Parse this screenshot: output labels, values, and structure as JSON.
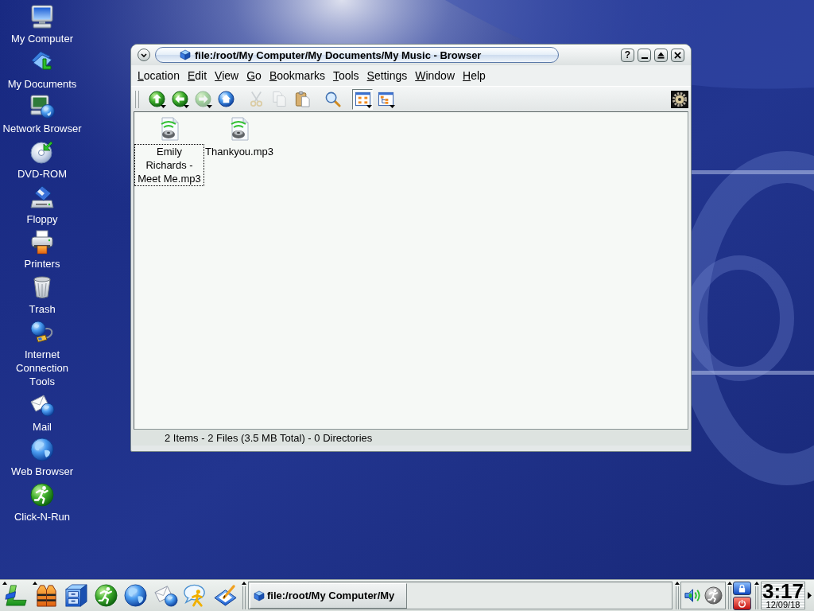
{
  "desktop_icons": [
    {
      "kind": "computer",
      "label": "My Computer"
    },
    {
      "kind": "documents",
      "label": "My Documents"
    },
    {
      "kind": "network",
      "label": "Network Browser"
    },
    {
      "kind": "dvd",
      "label": "DVD-ROM"
    },
    {
      "kind": "floppy",
      "label": "Floppy"
    },
    {
      "kind": "printer",
      "label": "Printers"
    },
    {
      "kind": "trash",
      "label": "Trash"
    },
    {
      "kind": "internet-tools",
      "label": "Internet Connection Tools"
    },
    {
      "kind": "mail",
      "label": "Mail"
    },
    {
      "kind": "web",
      "label": "Web Browser"
    },
    {
      "kind": "run",
      "label": "Click-N-Run"
    }
  ],
  "window": {
    "title": "file:/root/My Computer/My Documents/My Music - Browser",
    "help_button": "?",
    "menu": [
      "Location",
      "Edit",
      "View",
      "Go",
      "Bookmarks",
      "Tools",
      "Settings",
      "Window",
      "Help"
    ],
    "toolbar": [
      {
        "kind": "up",
        "disabled": false,
        "pressed": false,
        "dropdown": true
      },
      {
        "kind": "back",
        "disabled": false,
        "pressed": false,
        "dropdown": true
      },
      {
        "kind": "forward",
        "disabled": true,
        "pressed": false,
        "dropdown": true
      },
      {
        "kind": "home",
        "disabled": false,
        "pressed": false,
        "dropdown": false
      },
      {
        "kind": "cut",
        "disabled": true,
        "pressed": false,
        "dropdown": false
      },
      {
        "kind": "copy",
        "disabled": true,
        "pressed": false,
        "dropdown": false
      },
      {
        "kind": "paste",
        "disabled": false,
        "pressed": false,
        "dropdown": false
      },
      {
        "kind": "find",
        "disabled": false,
        "pressed": false,
        "dropdown": false
      },
      {
        "kind": "icon-view",
        "disabled": false,
        "pressed": true,
        "dropdown": true
      },
      {
        "kind": "tree-view",
        "disabled": false,
        "pressed": false,
        "dropdown": true
      }
    ],
    "files": [
      {
        "name": "Emily Richards - Meet Me.mp3",
        "selected": true
      },
      {
        "name": "Thankyou.mp3",
        "selected": false
      }
    ],
    "status": "2 Items - 2 Files (3.5 MB Total) - 0 Directories"
  },
  "taskbar": {
    "launchers": [
      {
        "kind": "start",
        "menu": true
      },
      {
        "kind": "lifevest",
        "menu": true
      },
      {
        "kind": "cabinet",
        "menu": false
      },
      {
        "kind": "run",
        "menu": false
      },
      {
        "kind": "web",
        "menu": false
      },
      {
        "kind": "mail",
        "menu": false
      },
      {
        "kind": "chat",
        "menu": false
      },
      {
        "kind": "notes",
        "menu": false
      }
    ],
    "tasks": [
      {
        "label": "file:/root/My Computer/My"
      }
    ],
    "tray": [
      {
        "kind": "speaker"
      },
      {
        "kind": "runner"
      }
    ],
    "clock": {
      "time": "3:17",
      "date": "12/09/18"
    }
  }
}
